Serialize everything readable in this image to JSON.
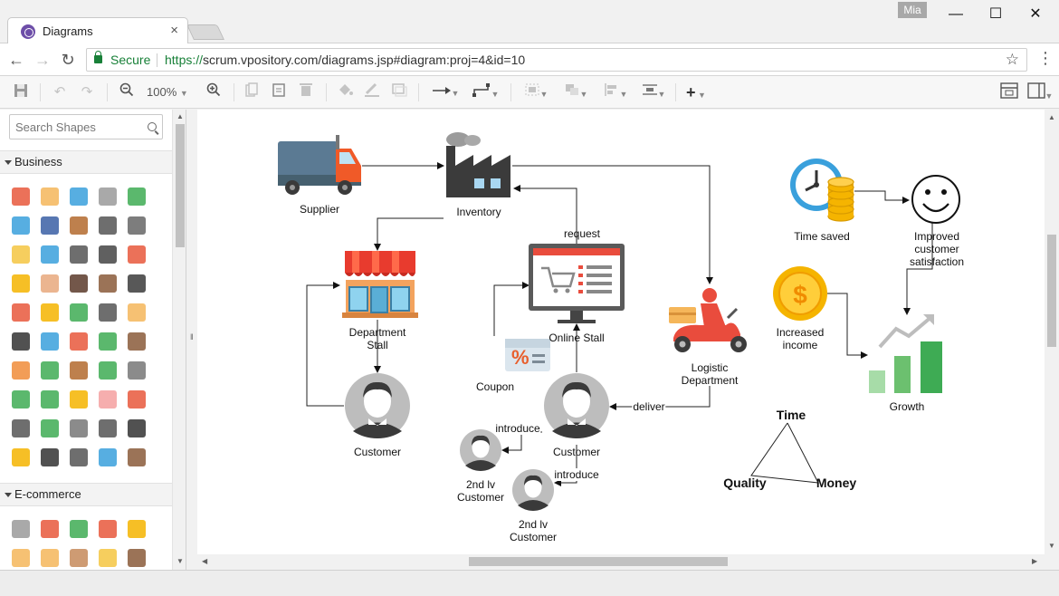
{
  "browser": {
    "tab_title": "Diagrams",
    "tab_close": "×",
    "user": "Mia",
    "secure_label": "Secure",
    "url_protocol": "https://",
    "url_rest": "scrum.vpository.com/diagrams.jsp#diagram:proj=4&id=10",
    "minimize": "—",
    "maximize": "☐",
    "close": "✕"
  },
  "toolbar": {
    "zoom": "100%"
  },
  "sidebar": {
    "search_placeholder": "Search Shapes",
    "categories": [
      "Business",
      "E-commerce"
    ]
  },
  "diagram": {
    "labels": {
      "supplier": "Supplier",
      "inventory": "Inventory",
      "request": "request",
      "time_saved": "Time saved",
      "improved_l1": "Improved",
      "improved_l2": "customer",
      "improved_l3": "satisfaction",
      "dept_l1": "Department",
      "dept_l2": "Stall",
      "online_stall": "Online Stall",
      "increased_l1": "Increased",
      "increased_l2": "income",
      "logistic_l1": "Logistic",
      "logistic_l2": "Department",
      "coupon": "Coupon",
      "customer_left": "Customer",
      "customer_center": "Customer",
      "deliver": "deliver",
      "growth": "Growth",
      "introduce_1": "introduce",
      "introduce_2": "introduce",
      "second_lv_1_l1": "2nd lv",
      "second_lv_1_l2": "Customer",
      "second_lv_2_l1": "2nd lv",
      "second_lv_2_l2": "Customer",
      "time": "Time",
      "quality": "Quality",
      "money": "Money"
    }
  },
  "colors": {
    "secure_green": "#188038",
    "truck_body": "#5b7a93",
    "truck_cab": "#f05a28",
    "factory": "#3b3b3b",
    "awning_red": "#e83b2e",
    "clock_blue": "#3aa0dc",
    "coin_gold": "#f5b400",
    "growth_green": "#3eab54"
  }
}
